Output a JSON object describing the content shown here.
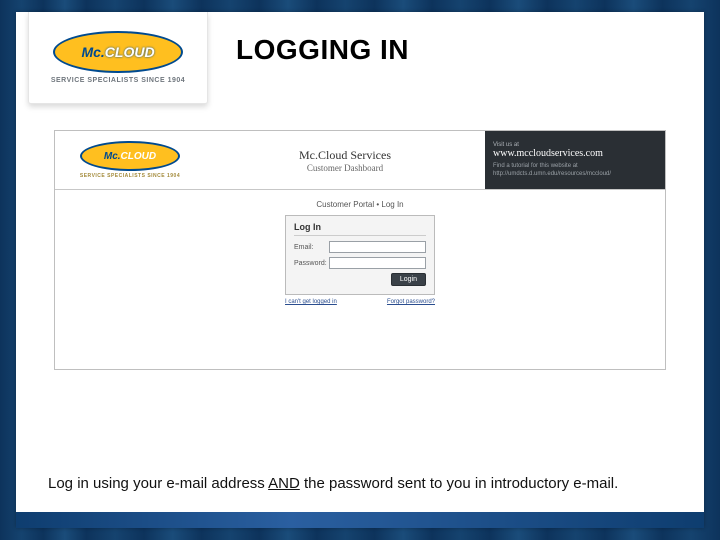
{
  "logo": {
    "brand_mc": "Mc.",
    "brand_cloud": "CLOUD",
    "tagline": "SERVICE SPECIALISTS SINCE 1904"
  },
  "slide": {
    "title": "LOGGING IN"
  },
  "screenshot": {
    "header": {
      "logo": {
        "mc": "Mc.",
        "cloud": "CLOUD",
        "tag": "SERVICE SPECIALISTS SINCE 1904"
      },
      "title_line1": "Mc.Cloud Services",
      "title_line2": "Customer Dashboard",
      "promo": {
        "visit": "Visit us at",
        "url": "www.mccloudservices.com",
        "tutorial": "Find a tutorial for this website at http://umdcts.d.umn.edu/resources/mccloud/"
      }
    },
    "crumb": "Customer Portal  •  Log In",
    "login": {
      "title": "Log In",
      "email_label": "Email:",
      "password_label": "Password:",
      "button": "Login"
    },
    "links": {
      "help": "I can't get logged in",
      "forgot": "Forgot password?"
    }
  },
  "caption": {
    "pre": "Log in using your e-mail address ",
    "and": "AND",
    "post": " the password sent to you in introductory e-mail."
  }
}
